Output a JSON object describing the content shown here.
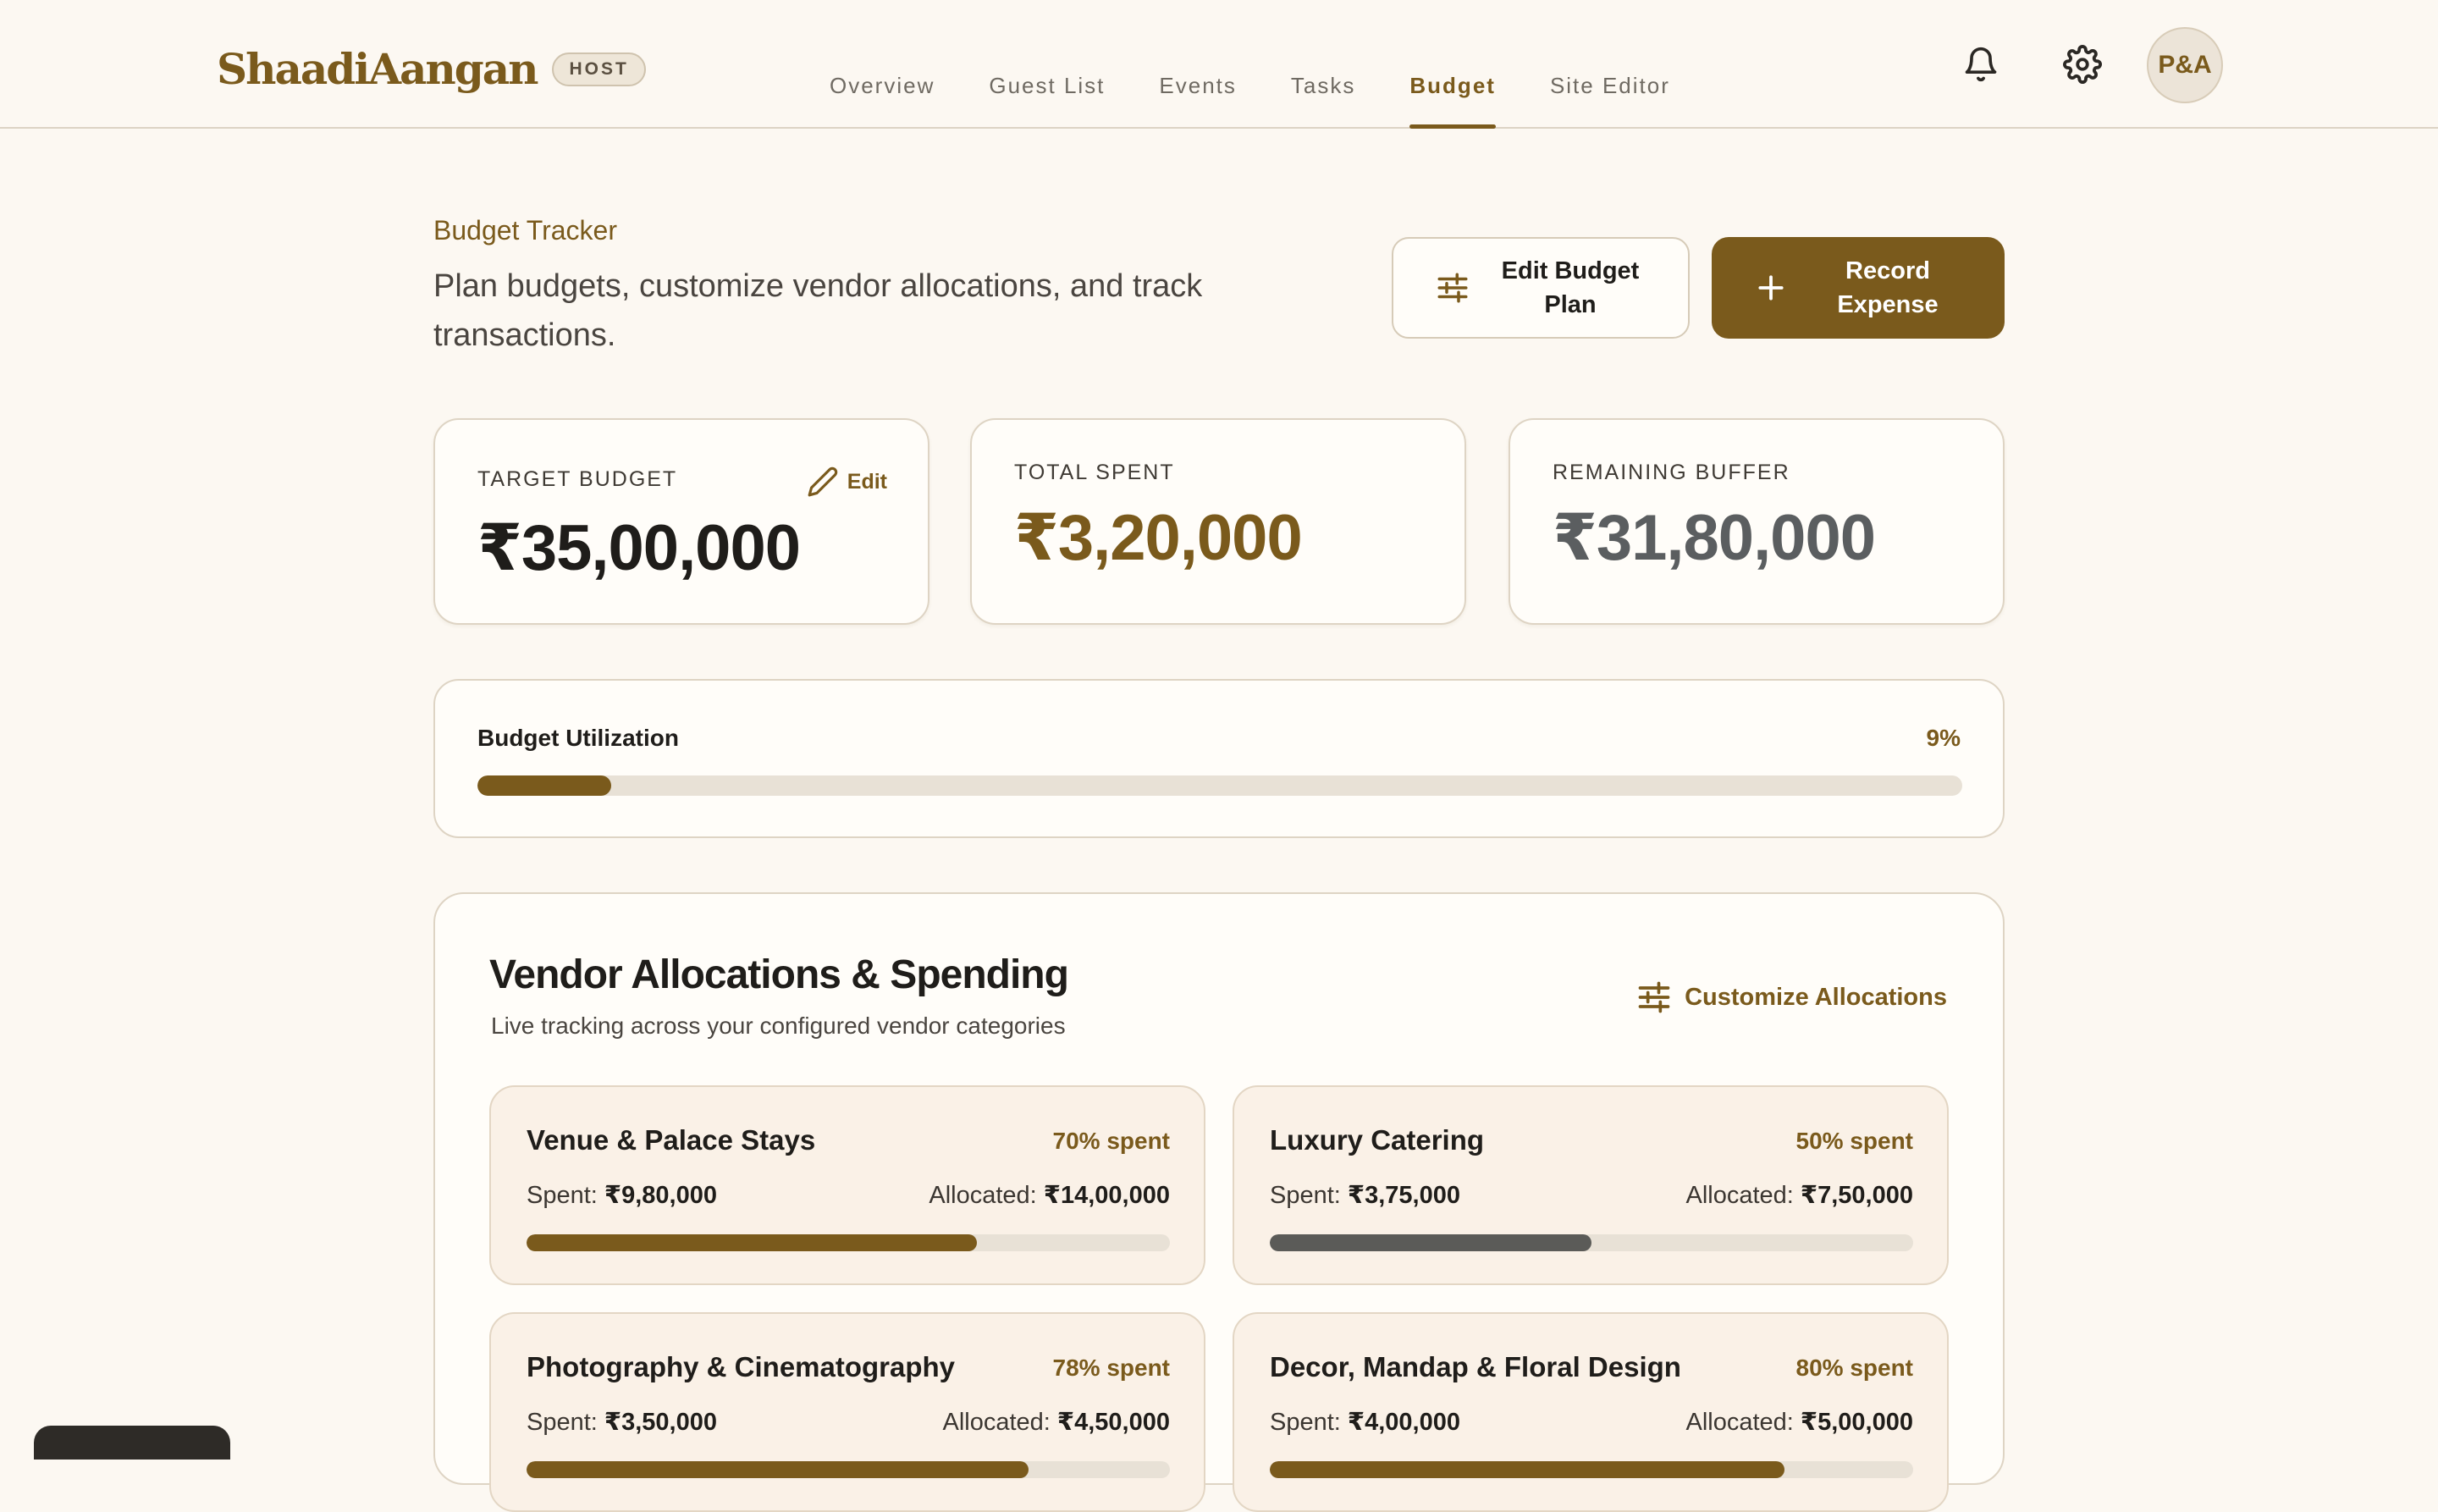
{
  "brand": {
    "name": "ShaadiAangan",
    "badge": "HOST"
  },
  "nav": [
    {
      "label": "Overview",
      "active": false
    },
    {
      "label": "Guest List",
      "active": false
    },
    {
      "label": "Events",
      "active": false
    },
    {
      "label": "Tasks",
      "active": false
    },
    {
      "label": "Budget",
      "active": true
    },
    {
      "label": "Site Editor",
      "active": false
    }
  ],
  "user": {
    "initials": "P&A"
  },
  "header": {
    "eyebrow": "Budget Tracker",
    "subtitle": "Plan budgets, customize vendor allocations, and track transactions."
  },
  "actions": {
    "edit_plan": "Edit Budget Plan",
    "record_expense": "Record Expense"
  },
  "stats": {
    "target": {
      "label": "TARGET BUDGET",
      "value": "₹35,00,000",
      "edit_label": "Edit"
    },
    "spent": {
      "label": "TOTAL SPENT",
      "value": "₹3,20,000"
    },
    "remaining": {
      "label": "REMAINING BUFFER",
      "value": "₹31,80,000"
    }
  },
  "utilization": {
    "label": "Budget Utilization",
    "percent_text": "9%",
    "percent": 9
  },
  "vendors": {
    "title": "Vendor Allocations & Spending",
    "subtitle": "Live tracking across your configured vendor categories",
    "customize_label": "Customize Allocations",
    "spent_prefix": "Spent: ",
    "allocated_prefix": "Allocated: ",
    "items": [
      {
        "name": "Venue & Palace Stays",
        "pct_text": "70% spent",
        "percent": 70,
        "spent": "₹9,80,000",
        "allocated": "₹14,00,000",
        "bar_color": "#7a5a1c"
      },
      {
        "name": "Luxury Catering",
        "pct_text": "50% spent",
        "percent": 50,
        "spent": "₹3,75,000",
        "allocated": "₹7,50,000",
        "bar_color": "#5b5b58"
      },
      {
        "name": "Photography & Cinematography",
        "pct_text": "78% spent",
        "percent": 78,
        "spent": "₹3,50,000",
        "allocated": "₹4,50,000",
        "bar_color": "#7a5a1c"
      },
      {
        "name": "Decor, Mandap & Floral Design",
        "pct_text": "80% spent",
        "percent": 80,
        "spent": "₹4,00,000",
        "allocated": "₹5,00,000",
        "bar_color": "#7a5a1c"
      }
    ]
  },
  "colors": {
    "accent": "#7a5a1c",
    "background": "#fcf8f2",
    "muted_value": "#5b5e60"
  },
  "icons": [
    "bell-icon",
    "gear-icon",
    "sliders-icon",
    "plus-icon",
    "pencil-icon"
  ]
}
